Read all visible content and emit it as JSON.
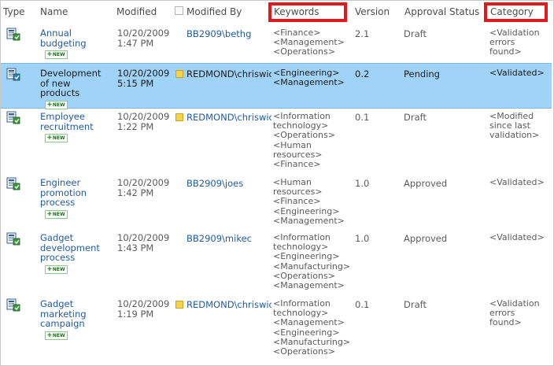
{
  "columns": {
    "type": "Type",
    "name": "Name",
    "modified": "Modified",
    "modified_by": "Modified By",
    "keywords": "Keywords",
    "version": "Version",
    "approval_status": "Approval Status",
    "category": "Category"
  },
  "colors": {
    "highlight_box": "#e0191f",
    "selected_row": "#9fd3f7",
    "link": "#1f5b9d"
  },
  "new_badge": "NEW",
  "rows": [
    {
      "name_lines": [
        "Annual",
        "budgeting"
      ],
      "modified_lines": [
        "10/20/2009",
        "1:47 PM"
      ],
      "modified_by": "BB2909\\bethg",
      "presence": false,
      "keywords": [
        "<Finance>",
        "<Management>",
        "<Operations>"
      ],
      "version": "2.1",
      "status": "Draft",
      "category": [
        "<Validation",
        "errors",
        "found>"
      ],
      "selected": false
    },
    {
      "name_lines": [
        "Development",
        "of new",
        "products"
      ],
      "modified_lines": [
        "10/20/2009",
        "5:15 PM"
      ],
      "modified_by": "REDMOND\\chriswic",
      "presence": true,
      "keywords": [
        "<Engineering>",
        "<Management>"
      ],
      "version": "0.2",
      "status": "Pending",
      "category": [
        "<Validated>"
      ],
      "selected": true
    },
    {
      "name_lines": [
        "Employee",
        "recruitment"
      ],
      "modified_lines": [
        "10/20/2009",
        "1:22 PM"
      ],
      "modified_by": "REDMOND\\chriswic",
      "presence": true,
      "keywords": [
        "<Information",
        "technology>",
        "<Operations>",
        "<Human",
        "resources>",
        "<Finance>"
      ],
      "version": "0.1",
      "status": "Draft",
      "category": [
        "<Modified",
        "since last",
        "validation>"
      ],
      "selected": false
    },
    {
      "name_lines": [
        "Engineer",
        "promotion",
        "process"
      ],
      "modified_lines": [
        "10/20/2009",
        "1:42 PM"
      ],
      "modified_by": "BB2909\\joes",
      "presence": false,
      "keywords": [
        "<Human",
        "resources>",
        "<Finance>",
        "<Engineering>",
        "<Management>"
      ],
      "version": "1.0",
      "status": "Approved",
      "category": [
        "<Validated>"
      ],
      "selected": false
    },
    {
      "name_lines": [
        "Gadget",
        "development",
        "process"
      ],
      "modified_lines": [
        "10/20/2009",
        "1:43 PM"
      ],
      "modified_by": "BB2909\\mikec",
      "presence": false,
      "keywords": [
        "<Information",
        "technology>",
        "<Engineering>",
        "<Manufacturing>",
        "<Operations>",
        "<Management>"
      ],
      "version": "1.0",
      "status": "Approved",
      "category": [
        "<Validated>"
      ],
      "selected": false
    },
    {
      "name_lines": [
        "Gadget",
        "marketing",
        "campaign"
      ],
      "modified_lines": [
        "10/20/2009",
        "1:19 PM"
      ],
      "modified_by": "REDMOND\\chriswic",
      "presence": true,
      "keywords": [
        "<Information",
        "technology>",
        "<Management>",
        "<Engineering>",
        "<Manufacturing>",
        "<Operations>"
      ],
      "version": "0.1",
      "status": "Draft",
      "category": [
        "<Validation",
        "errors",
        "found>"
      ],
      "selected": false
    }
  ]
}
